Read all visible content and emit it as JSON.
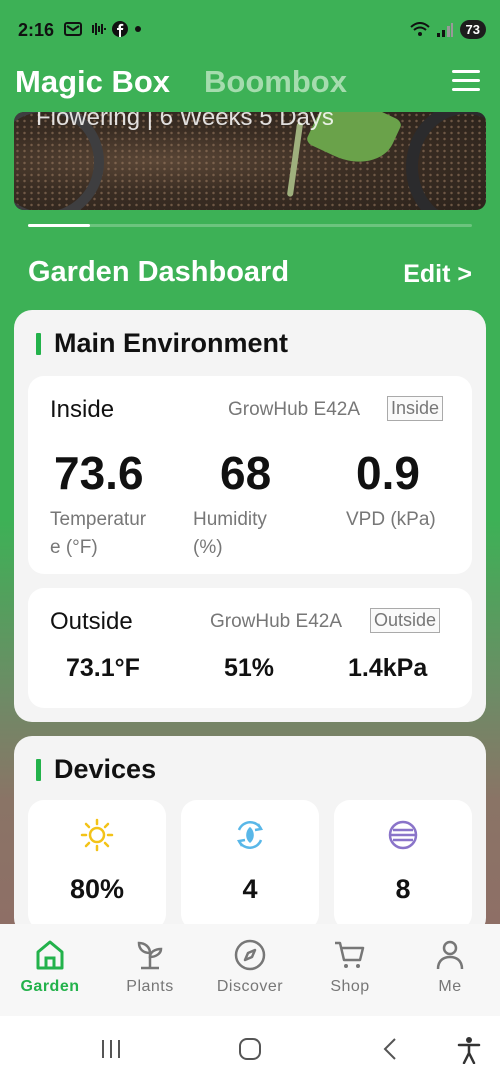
{
  "status_bar": {
    "time": "2:16",
    "battery": "73",
    "icons": [
      "gmail-icon",
      "voicemail-icon",
      "facebook-icon",
      "dot-icon",
      "wifi-icon",
      "signal-icon",
      "battery-icon"
    ]
  },
  "header": {
    "tabs": [
      {
        "label": "Magic Box",
        "active": true
      },
      {
        "label": "Boombox",
        "active": false
      }
    ]
  },
  "banner": {
    "caption": "Flowering | 6 Weeks 5 Days",
    "progress": 0.14
  },
  "dashboard": {
    "title": "Garden Dashboard",
    "edit_label": "Edit >"
  },
  "environment": {
    "title": "Main Environment",
    "inside": {
      "label": "Inside",
      "hub": "GrowHub E42A",
      "tag": "Inside",
      "temperature": {
        "value": "73.6",
        "label1": "Temperatur",
        "label2": "e (°F)"
      },
      "humidity": {
        "value": "68",
        "label1": "Humidity",
        "label2": "(%)"
      },
      "vpd": {
        "value": "0.9",
        "label1": "VPD (kPa)"
      }
    },
    "outside": {
      "label": "Outside",
      "hub": "GrowHub E42A",
      "tag": "Outside",
      "temperature": "73.1°F",
      "humidity": "51%",
      "vpd": "1.4kPa"
    }
  },
  "devices": {
    "title": "Devices",
    "tiles": [
      {
        "icon": "sun-icon",
        "value": "80%",
        "color": "#f3c318"
      },
      {
        "icon": "recycle-leaf-icon",
        "value": "4",
        "color": "#59b7e8"
      },
      {
        "icon": "fan-icon",
        "value": "8",
        "color": "#8a74c9"
      }
    ]
  },
  "bottom_nav": [
    {
      "label": "Garden",
      "icon": "home-icon",
      "active": true
    },
    {
      "label": "Plants",
      "icon": "sprout-icon",
      "active": false
    },
    {
      "label": "Discover",
      "icon": "compass-icon",
      "active": false
    },
    {
      "label": "Shop",
      "icon": "cart-icon",
      "active": false
    },
    {
      "label": "Me",
      "icon": "person-icon",
      "active": false
    }
  ],
  "colors": {
    "brand_green": "#3db156",
    "accent_green": "#23b24b"
  }
}
